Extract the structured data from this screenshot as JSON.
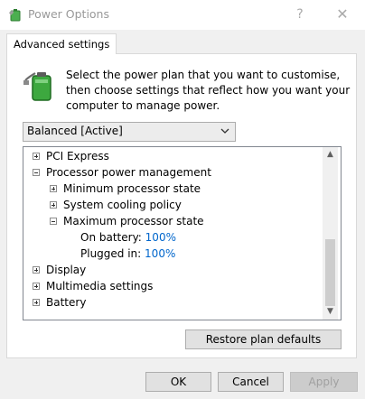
{
  "window": {
    "title": "Power Options",
    "help_glyph": "?",
    "close_glyph": "✕"
  },
  "tab": {
    "label": "Advanced settings"
  },
  "description": "Select the power plan that you want to customise, then choose settings that reflect how you want your computer to manage power.",
  "plan_select": {
    "value": "Balanced [Active]"
  },
  "tree": {
    "items": [
      {
        "label": "PCI Express",
        "expander": "plus"
      },
      {
        "label": "Processor power management",
        "expander": "minus"
      },
      {
        "label": "Minimum processor state",
        "expander": "plus"
      },
      {
        "label": "System cooling policy",
        "expander": "plus"
      },
      {
        "label": "Maximum processor state",
        "expander": "minus"
      },
      {
        "label": "On battery:",
        "value": "100%"
      },
      {
        "label": "Plugged in:",
        "value": "100%"
      },
      {
        "label": "Display",
        "expander": "plus"
      },
      {
        "label": "Multimedia settings",
        "expander": "plus"
      },
      {
        "label": "Battery",
        "expander": "plus"
      }
    ]
  },
  "scrollbar": {
    "up_glyph": "▲",
    "down_glyph": "▼"
  },
  "buttons": {
    "restore": "Restore plan defaults",
    "ok": "OK",
    "cancel": "Cancel",
    "apply": "Apply"
  },
  "colors": {
    "value_link": "#0066cc",
    "battery_green": "#3da83f"
  }
}
